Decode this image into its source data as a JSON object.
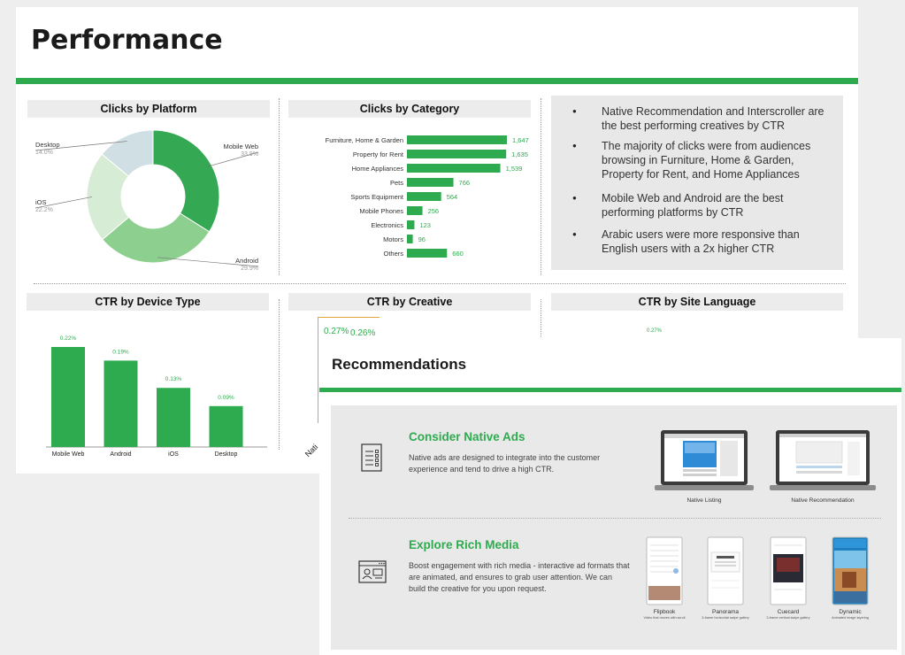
{
  "performance": {
    "title": "Performance",
    "panels": {
      "clicks_by_platform": "Clicks by Platform",
      "clicks_by_category": "Clicks by Category",
      "ctr_by_device": "CTR by Device Type",
      "ctr_by_creative": "CTR by Creative",
      "ctr_by_language": "CTR by Site Language"
    },
    "bullets": [
      "Native Recommendation and Interscroller are the best performing creatives by CTR",
      "The majority of clicks were from audiences browsing in Furniture, Home & Garden, Property for Rent, and Home Appliances",
      "Mobile Web and Android are the best performing platforms by CTR",
      "Arabic users were more responsive than English users with a 2x higher CTR"
    ],
    "creative_partial_labels": [
      "0.27%",
      "0.26%"
    ],
    "creative_axis_partial": "Nati",
    "language_partial_label": "0.27%"
  },
  "recommendations": {
    "title": "Recommendations",
    "items": [
      {
        "title": "Consider Native Ads",
        "text": "Native ads are designed to integrate into the customer experience and tend to drive a high CTR.",
        "icon": "list-document-icon",
        "images": [
          {
            "caption": "Native Listing"
          },
          {
            "caption": "Native Recommendation"
          }
        ]
      },
      {
        "title": "Explore Rich Media",
        "text": "Boost engagement with rich media - interactive ad formats that are animated, and ensures to grab user attention. We can build the creative for you upon request.",
        "icon": "browser-media-icon",
        "images": [
          {
            "caption": "Flipbook",
            "sub": "Video that moves with scroll"
          },
          {
            "caption": "Panorama",
            "sub": "3-frame horizontal swipe gallery"
          },
          {
            "caption": "Cuecard",
            "sub": "3-frame vertical swipe gallery"
          },
          {
            "caption": "Dynamic",
            "sub": "Animated image layering"
          }
        ]
      }
    ]
  },
  "colors": {
    "accent": "#2eab4f",
    "panel": "#ececec"
  },
  "chart_data": [
    {
      "type": "pie",
      "title": "Clicks by Platform",
      "categories": [
        "Mobile Web",
        "Android",
        "iOS",
        "Desktop"
      ],
      "values": [
        33.9,
        29.9,
        22.2,
        14.0
      ],
      "value_labels": [
        "33.9%",
        "29.9%",
        "22.2%",
        "14.0%"
      ],
      "colors": [
        "#34a853",
        "#8ccf8e",
        "#d7ecd4",
        "#cfdfe3"
      ]
    },
    {
      "type": "bar",
      "orientation": "horizontal",
      "title": "Clicks by Category",
      "categories": [
        "Furniture, Home & Garden",
        "Property for Rent",
        "Home Appliances",
        "Pets",
        "Sports Equipment",
        "Mobile Phones",
        "Electronics",
        "Motors",
        "Others"
      ],
      "values": [
        1647,
        1635,
        1539,
        766,
        564,
        256,
        123,
        96,
        660
      ],
      "value_labels": [
        "1,647",
        "1,635",
        "1,539",
        "766",
        "564",
        "256",
        "123",
        "96",
        "660"
      ],
      "xlim": [
        0,
        1647
      ]
    },
    {
      "type": "bar",
      "title": "CTR by Device Type",
      "categories": [
        "Mobile Web",
        "Android",
        "iOS",
        "Desktop"
      ],
      "values": [
        0.22,
        0.19,
        0.13,
        0.09
      ],
      "value_labels": [
        "0.22%",
        "0.19%",
        "0.13%",
        "0.09%"
      ],
      "ylim": [
        0,
        0.22
      ]
    }
  ]
}
